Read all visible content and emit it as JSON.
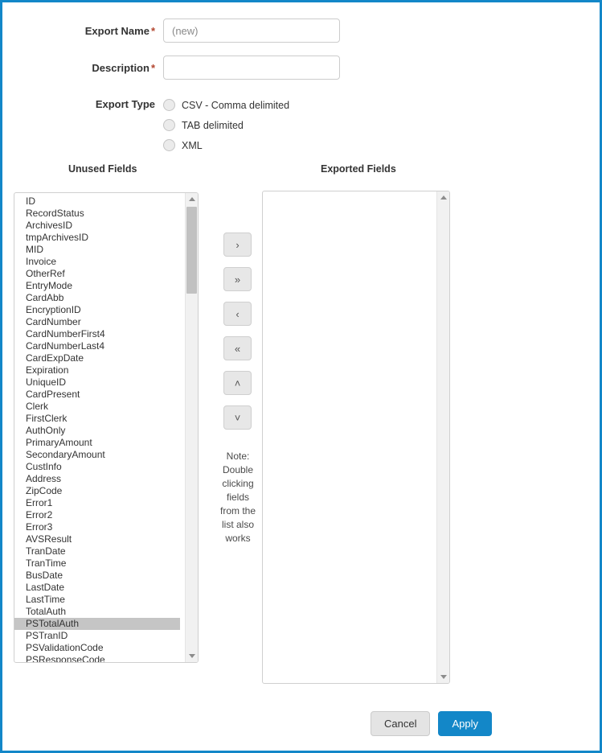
{
  "theme": {
    "accent": "#1387c8",
    "required_star": "#b2452e",
    "selection_bg": "#c5c5c5",
    "button_gray": "#e4e4e4"
  },
  "form": {
    "export_name": {
      "label": "Export Name",
      "required_marker": "*",
      "value": "",
      "placeholder": "(new)"
    },
    "description": {
      "label": "Description",
      "required_marker": "*",
      "value": "",
      "placeholder": ""
    },
    "export_type": {
      "label": "Export Type",
      "selected": null,
      "options": [
        {
          "label": "CSV - Comma delimited",
          "checked": false
        },
        {
          "label": "TAB delimited",
          "checked": false
        },
        {
          "label": "XML",
          "checked": false
        }
      ]
    }
  },
  "unused_fields": {
    "heading": "Unused Fields",
    "selected": "PSTotalAuth",
    "items": [
      "ID",
      "RecordStatus",
      "ArchivesID",
      "tmpArchivesID",
      "MID",
      "Invoice",
      "OtherRef",
      "EntryMode",
      "CardAbb",
      "EncryptionID",
      "CardNumber",
      "CardNumberFirst4",
      "CardNumberLast4",
      "CardExpDate",
      "Expiration",
      "UniqueID",
      "CardPresent",
      "Clerk",
      "FirstClerk",
      "AuthOnly",
      "PrimaryAmount",
      "SecondaryAmount",
      "CustInfo",
      "Address",
      "ZipCode",
      "Error1",
      "Error2",
      "Error3",
      "AVSResult",
      "TranDate",
      "TranTime",
      "BusDate",
      "LastDate",
      "LastTime",
      "TotalAuth",
      "PSTotalAuth",
      "PSTranID",
      "PSValidationCode",
      "PSResponseCode"
    ]
  },
  "exported_fields": {
    "heading": "Exported Fields",
    "items": []
  },
  "transfer_buttons": [
    {
      "icon": "chevron-right-icon",
      "glyph": "›",
      "name": "move-right-button"
    },
    {
      "icon": "chevron-double-right-icon",
      "glyph": "»",
      "name": "move-all-right-button"
    },
    {
      "icon": "chevron-left-icon",
      "glyph": "‹",
      "name": "move-left-button"
    },
    {
      "icon": "chevron-double-left-icon",
      "glyph": "«",
      "name": "move-all-left-button"
    },
    {
      "icon": "chevron-up-icon",
      "glyph": "˄",
      "name": "move-up-button"
    },
    {
      "icon": "chevron-down-icon",
      "glyph": "˅",
      "name": "move-down-button"
    }
  ],
  "note": {
    "text": "Note: Double clicking fields from the list also works"
  },
  "footer": {
    "cancel_label": "Cancel",
    "apply_label": "Apply"
  }
}
